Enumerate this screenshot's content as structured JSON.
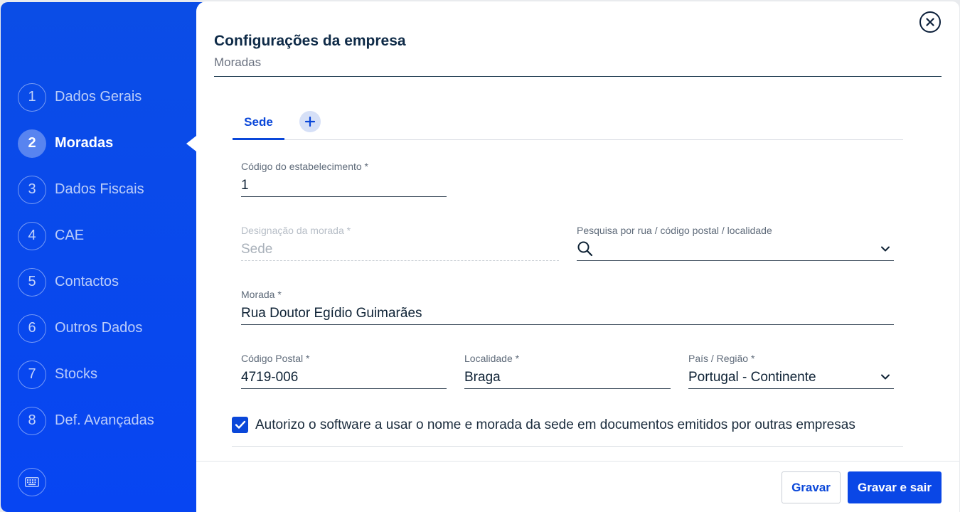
{
  "sidebar": {
    "steps": [
      {
        "num": "1",
        "label": "Dados Gerais"
      },
      {
        "num": "2",
        "label": "Moradas"
      },
      {
        "num": "3",
        "label": "Dados Fiscais"
      },
      {
        "num": "4",
        "label": "CAE"
      },
      {
        "num": "5",
        "label": "Contactos"
      },
      {
        "num": "6",
        "label": "Outros Dados"
      },
      {
        "num": "7",
        "label": "Stocks"
      },
      {
        "num": "8",
        "label": "Def. Avançadas"
      }
    ],
    "active_step": "2",
    "keyboard_icon": "keyboard-icon"
  },
  "header": {
    "title": "Configurações da empresa",
    "subtitle": "Moradas"
  },
  "tabs": {
    "sede_label": "Sede",
    "add_icon": "plus-icon"
  },
  "form": {
    "codigo_estabelecimento": {
      "label": "Código do estabelecimento *",
      "value": "1"
    },
    "designacao_morada": {
      "label": "Designação da morada *",
      "value": "Sede"
    },
    "pesquisa": {
      "label": "Pesquisa por rua / código postal / localidade",
      "value": ""
    },
    "morada": {
      "label": "Morada *",
      "value": "Rua Doutor Egídio Guimarães"
    },
    "codigo_postal": {
      "label": "Código Postal *",
      "value": "4719-006"
    },
    "localidade": {
      "label": "Localidade *",
      "value": "Braga"
    },
    "pais_regiao": {
      "label": "País / Região *",
      "value": "Portugal - Continente"
    },
    "autorizo": {
      "label": "Autorizo o software a usar o nome e morada da sede em documentos emitidos por outras empresas",
      "checked": true
    }
  },
  "footer": {
    "gravar_label": "Gravar",
    "gravar_sair_label": "Gravar e sair"
  },
  "colors": {
    "accent": "#0a47e6",
    "sidebar": "#0745f2"
  }
}
